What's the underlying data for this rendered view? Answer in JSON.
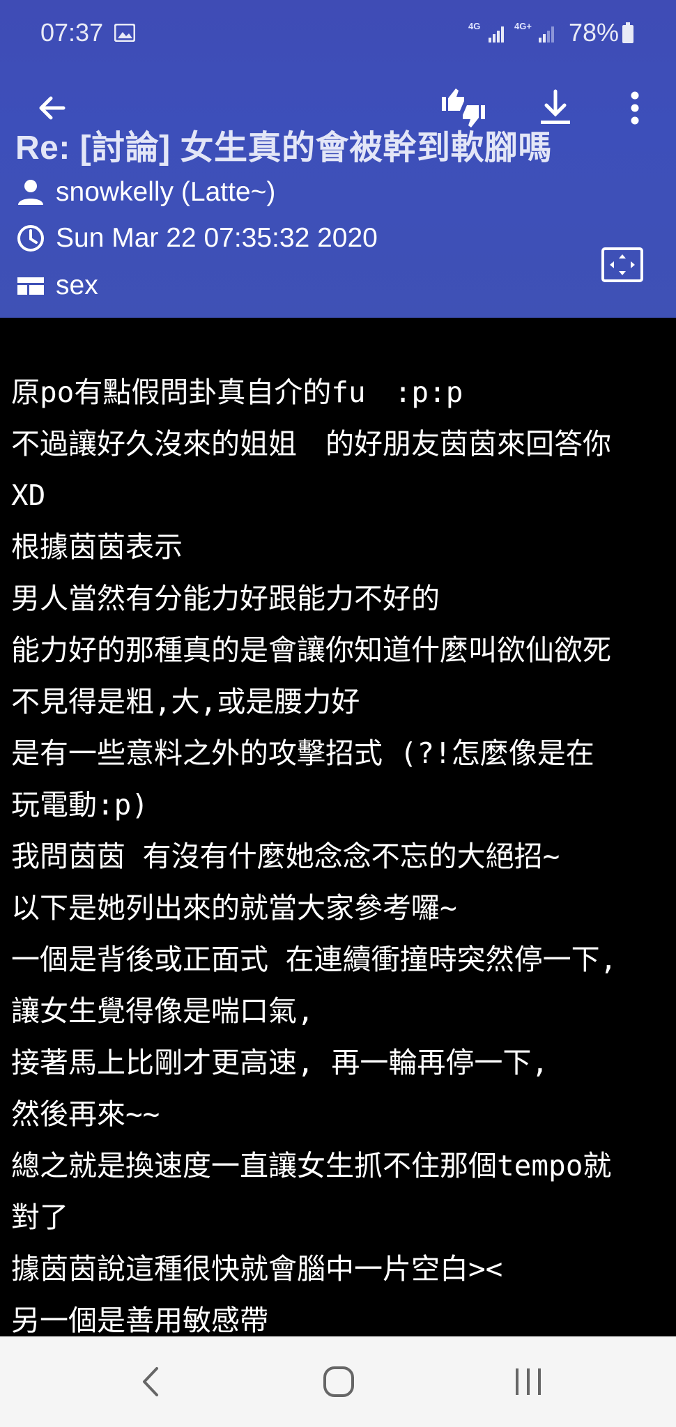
{
  "status_bar": {
    "time": "07:37",
    "network_1": "4G",
    "network_2": "4G+",
    "battery": "78%",
    "icons": [
      "image-icon",
      "signal-icon",
      "signal-icon",
      "battery-icon"
    ]
  },
  "toolbar": {
    "back_icon": "arrow-left-icon",
    "vote_icon": "thumbs-up-down-icon",
    "download_icon": "download-icon",
    "more_icon": "more-vertical-icon"
  },
  "post": {
    "title": "Re: [討論] 女生真的會被幹到軟腳嗎",
    "author": "snowkelly (Latte~)",
    "date": "Sun Mar 22 07:35:32 2020",
    "board": "sex"
  },
  "body_lines": [
    "原po有點假問卦真自介的fu　:p:p",
    "不過讓好久沒來的姐姐　的好朋友茵茵來回答你",
    "XD",
    "根據茵茵表示",
    "男人當然有分能力好跟能力不好的",
    "能力好的那種真的是會讓你知道什麼叫欲仙欲死",
    "不見得是粗,大,或是腰力好",
    "是有一些意料之外的攻擊招式 (?!怎麼像是在",
    "玩電動:p)",
    "我問茵茵  有沒有什麼她念念不忘的大絕招~",
    "以下是她列出來的就當大家參考囉~",
    "一個是背後或正面式  在連續衝撞時突然停一下,",
    "讓女生覺得像是喘口氣,",
    "接著馬上比剛才更高速, 再一輪再停一下,",
    "然後再來~~",
    "總之就是換速度一直讓女生抓不住那個tempo就",
    "對了",
    "據茵茵說這種很快就會腦中一片空白><",
    "另一個是善用敏感帶"
  ],
  "colors": {
    "header_bg": "#3f51b5",
    "content_bg": "#000000",
    "text": "#ffffff",
    "navbar_bg": "#f5f5f5"
  }
}
